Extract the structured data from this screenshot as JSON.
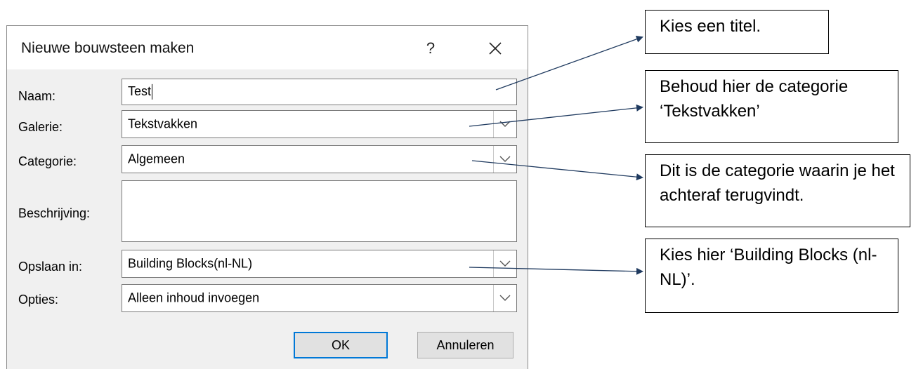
{
  "dialog": {
    "title": "Nieuwe bouwsteen maken",
    "help_label": "?",
    "fields": {
      "naam": {
        "label": "Naam:",
        "value": "Test"
      },
      "galerie": {
        "label": "Galerie:",
        "value": "Tekstvakken"
      },
      "categorie": {
        "label": "Categorie:",
        "value": "Algemeen"
      },
      "beschrijving": {
        "label": "Beschrijving:",
        "value": ""
      },
      "opslaan": {
        "label": "Opslaan in:",
        "value": "Building Blocks(nl-NL)"
      },
      "opties": {
        "label": "Opties:",
        "value": "Alleen inhoud invoegen"
      }
    },
    "ok_label": "OK",
    "cancel_label": "Annuleren"
  },
  "callouts": {
    "titel": "Kies een titel.",
    "tekstvakken": "Behoud hier de categorie ‘Tekstvakken’",
    "categorie": "Dit is de categorie waarin je het achteraf terugvindt.",
    "building_blocks": "Kies hier ‘Building Blocks (nl-NL)’."
  },
  "colors": {
    "ok_border": "#0078d7",
    "dialog_bg": "#f0f0f0",
    "arrow": "#1f3a5f"
  },
  "icons": [
    "close-icon",
    "chevron-down-icon"
  ]
}
